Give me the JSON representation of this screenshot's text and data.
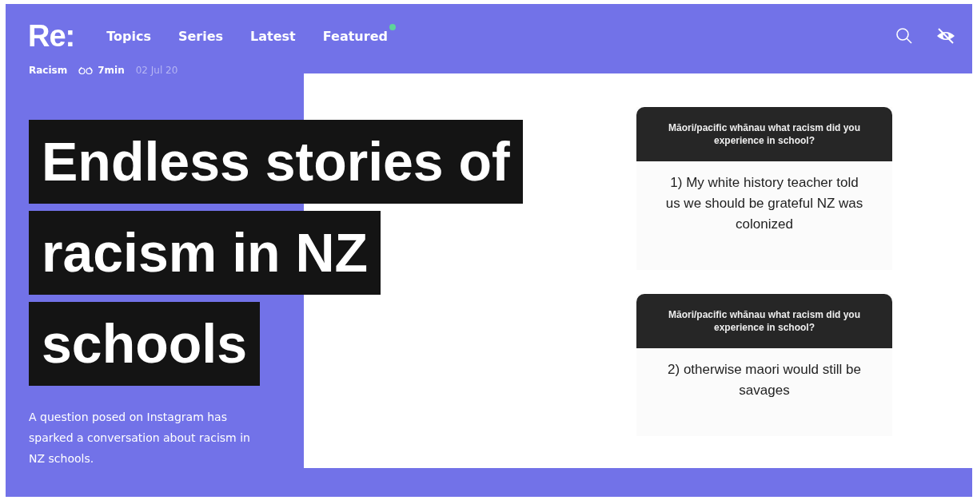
{
  "header": {
    "logo": "Re:",
    "nav": [
      {
        "label": "Topics",
        "badge": false
      },
      {
        "label": "Series",
        "badge": false
      },
      {
        "label": "Latest",
        "badge": false
      },
      {
        "label": "Featured",
        "badge": true
      }
    ]
  },
  "meta": {
    "topic": "Racism",
    "read_time": "7min",
    "date": "02 Jul 20"
  },
  "title_lines": [
    "Endless stories of",
    "racism in NZ",
    "schools"
  ],
  "summary": "A question posed on Instagram has sparked a conversation about racism in NZ schools.",
  "screenshot": {
    "cards": [
      {
        "question": "Māori/pacific whānau what racism did you experience in school?",
        "answer": "1) My white history teacher told us we should be grateful NZ was colonized"
      },
      {
        "question": "Māori/pacific whānau what racism did you experience in school?",
        "answer": "2) otherwise maori would still be savages"
      }
    ]
  }
}
